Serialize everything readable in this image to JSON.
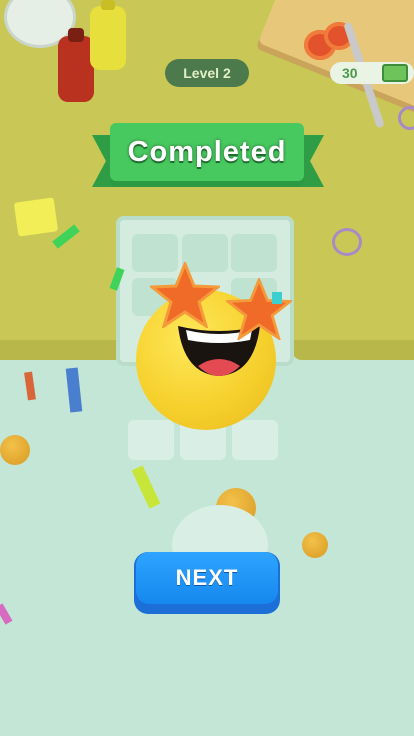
{
  "hud": {
    "level_label": "Level 2",
    "cash_amount": "30",
    "cash_icon": "cash-icon"
  },
  "banner": {
    "text": "Completed"
  },
  "actions": {
    "next_label": "NEXT"
  },
  "colors": {
    "table": "#c9c857",
    "floor": "#c3e6d6",
    "banner": "#48c95f",
    "next_button": "#1e90f5"
  }
}
